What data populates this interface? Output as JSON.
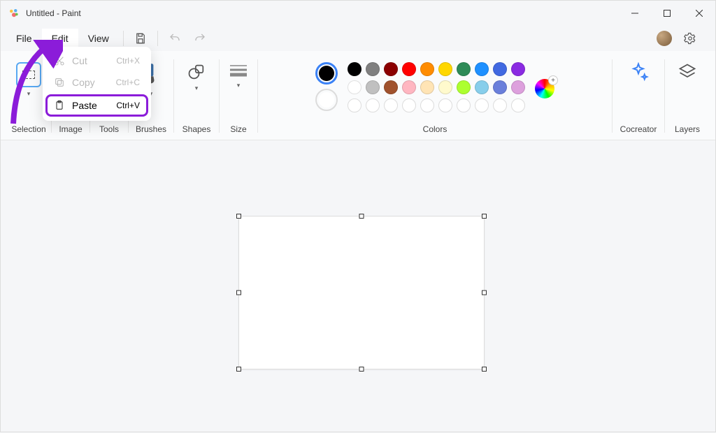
{
  "title": "Untitled - Paint",
  "menu": {
    "file": "File",
    "edit": "Edit",
    "view": "View"
  },
  "edit_menu": {
    "cut": {
      "label": "Cut",
      "shortcut": "Ctrl+X"
    },
    "copy": {
      "label": "Copy",
      "shortcut": "Ctrl+C"
    },
    "paste": {
      "label": "Paste",
      "shortcut": "Ctrl+V"
    }
  },
  "ribbon": {
    "selection": "Selection",
    "image": "Image",
    "tools": "Tools",
    "brushes": "Brushes",
    "shapes": "Shapes",
    "size": "Size",
    "colors": "Colors",
    "cocreator": "Cocreator",
    "layers": "Layers"
  },
  "palette": {
    "row1": [
      "#000000",
      "#808080",
      "#8B0000",
      "#FF0000",
      "#FF8C00",
      "#FFD700",
      "#2E8B57",
      "#1E90FF",
      "#4169E1",
      "#8A2BE2"
    ],
    "row2": [
      "#FFFFFF",
      "#C0C0C0",
      "#A0522D",
      "#FFB6C1",
      "#FFE4B5",
      "#FFFACD",
      "#ADFF2F",
      "#87CEEB",
      "#6A7FDB",
      "#DDA0DD"
    ]
  }
}
